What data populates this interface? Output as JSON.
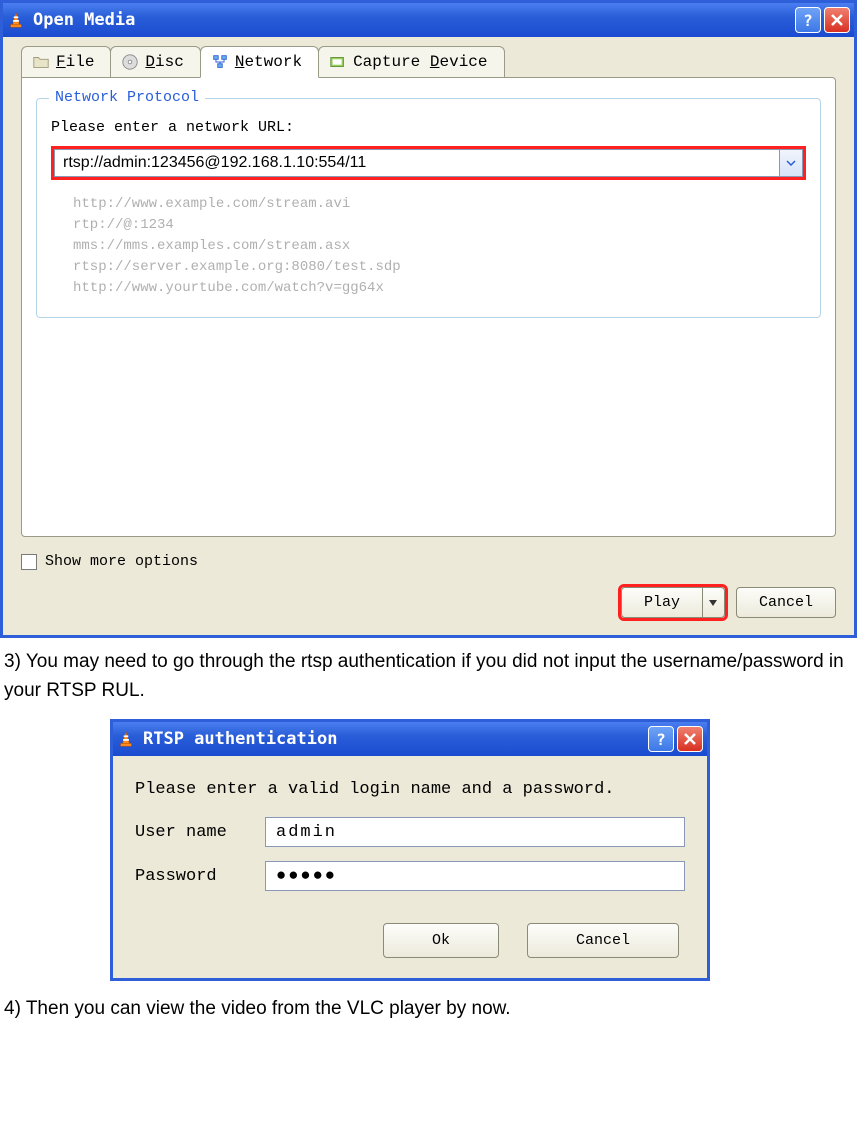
{
  "open_media": {
    "title": "Open Media",
    "tabs": {
      "file": "File",
      "disc": "Disc",
      "network": "Network",
      "capture": "Capture Device"
    },
    "fieldset_legend": "Network Protocol",
    "url_label": "Please enter a network URL:",
    "url_value": "rtsp://admin:123456@192.168.1.10:554/11",
    "examples": "http://www.example.com/stream.avi\nrtp://@:1234\nmms://mms.examples.com/stream.asx\nrtsp://server.example.org:8080/test.sdp\nhttp://www.yourtube.com/watch?v=gg64x",
    "show_more": "Show more options",
    "play": "Play",
    "cancel": "Cancel"
  },
  "step3": "3) You may need to go through the rtsp authentication if you did not input the username/password in your RTSP RUL.",
  "auth": {
    "title": "RTSP authentication",
    "prompt": "Please enter a valid login name and a password.",
    "user_label": "User name",
    "user_value": "admin",
    "pass_label": "Password",
    "pass_value": "●●●●●",
    "ok": "Ok",
    "cancel": "Cancel"
  },
  "step4": "4) Then you can view the video from the VLC player by now."
}
